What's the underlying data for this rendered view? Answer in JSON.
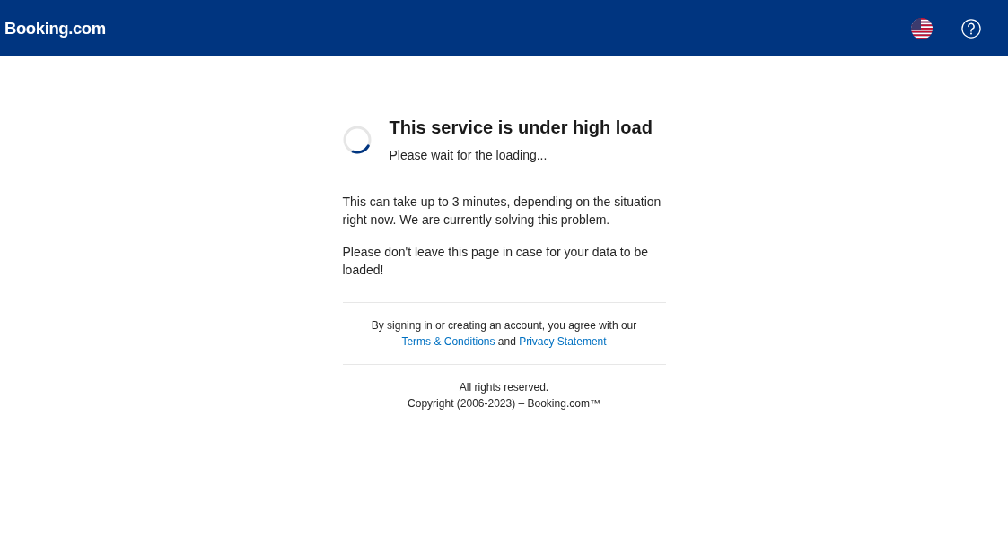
{
  "header": {
    "logo": "Booking.com"
  },
  "loader": {
    "title": "This service is under high load",
    "subtitle": "Please wait for the loading..."
  },
  "paragraphs": [
    "This can take up to 3 minutes, depending on the situation right now. We are currently solving this problem.",
    "Please don't leave this page in case for your data to be loaded!"
  ],
  "legal": {
    "text_before": "By signing in or creating an account, you agree with our",
    "terms_link": "Terms & Conditions",
    "text_between": "and",
    "privacy_link": "Privacy Statement"
  },
  "footer": {
    "rights": "All rights reserved.",
    "copyright": "Copyright (2006-2023) – Booking.com™"
  }
}
